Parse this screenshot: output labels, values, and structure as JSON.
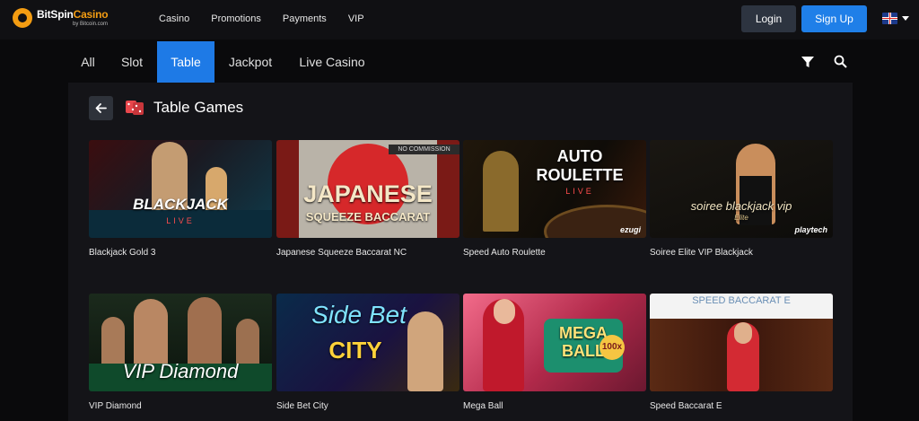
{
  "header": {
    "brand_name_a": "BitSpin",
    "brand_name_b": "Casino",
    "brand_by": "by Bitcoin.com",
    "nav": [
      "Casino",
      "Promotions",
      "Payments",
      "VIP"
    ],
    "login_label": "Login",
    "signup_label": "Sign Up"
  },
  "tabs": [
    "All",
    "Slot",
    "Table",
    "Jackpot",
    "Live Casino"
  ],
  "active_tab": "Table",
  "section": {
    "title": "Table Games"
  },
  "games": [
    {
      "name": "Blackjack Gold 3",
      "art": "BLACKJACK",
      "sub": "LIVE"
    },
    {
      "name": "Japanese Squeeze Baccarat NC",
      "art": "JAPANESE",
      "sub": "SQUEEZE BACCARAT",
      "badge": "NO COMMISSION"
    },
    {
      "name": "Speed Auto Roulette",
      "art": "AUTO ROULETTE",
      "sub": "LIVE",
      "provider": "ezugi"
    },
    {
      "name": "Soiree Elite VIP Blackjack",
      "art": "soiree blackjack vip",
      "sub": "Elite",
      "provider": "playtech"
    },
    {
      "name": "VIP Diamond",
      "art": "VIP Diamond"
    },
    {
      "name": "Side Bet City",
      "art": "Side Bet",
      "sub": "CITY"
    },
    {
      "name": "Mega Ball",
      "art": "MEGA BALL",
      "badge": "100x"
    },
    {
      "name": "Speed Baccarat E",
      "art": "SPEED BACCARAT E"
    }
  ],
  "colors": {
    "accent": "#1e7ae6",
    "brand": "#f39c12",
    "panel": "#141418"
  }
}
